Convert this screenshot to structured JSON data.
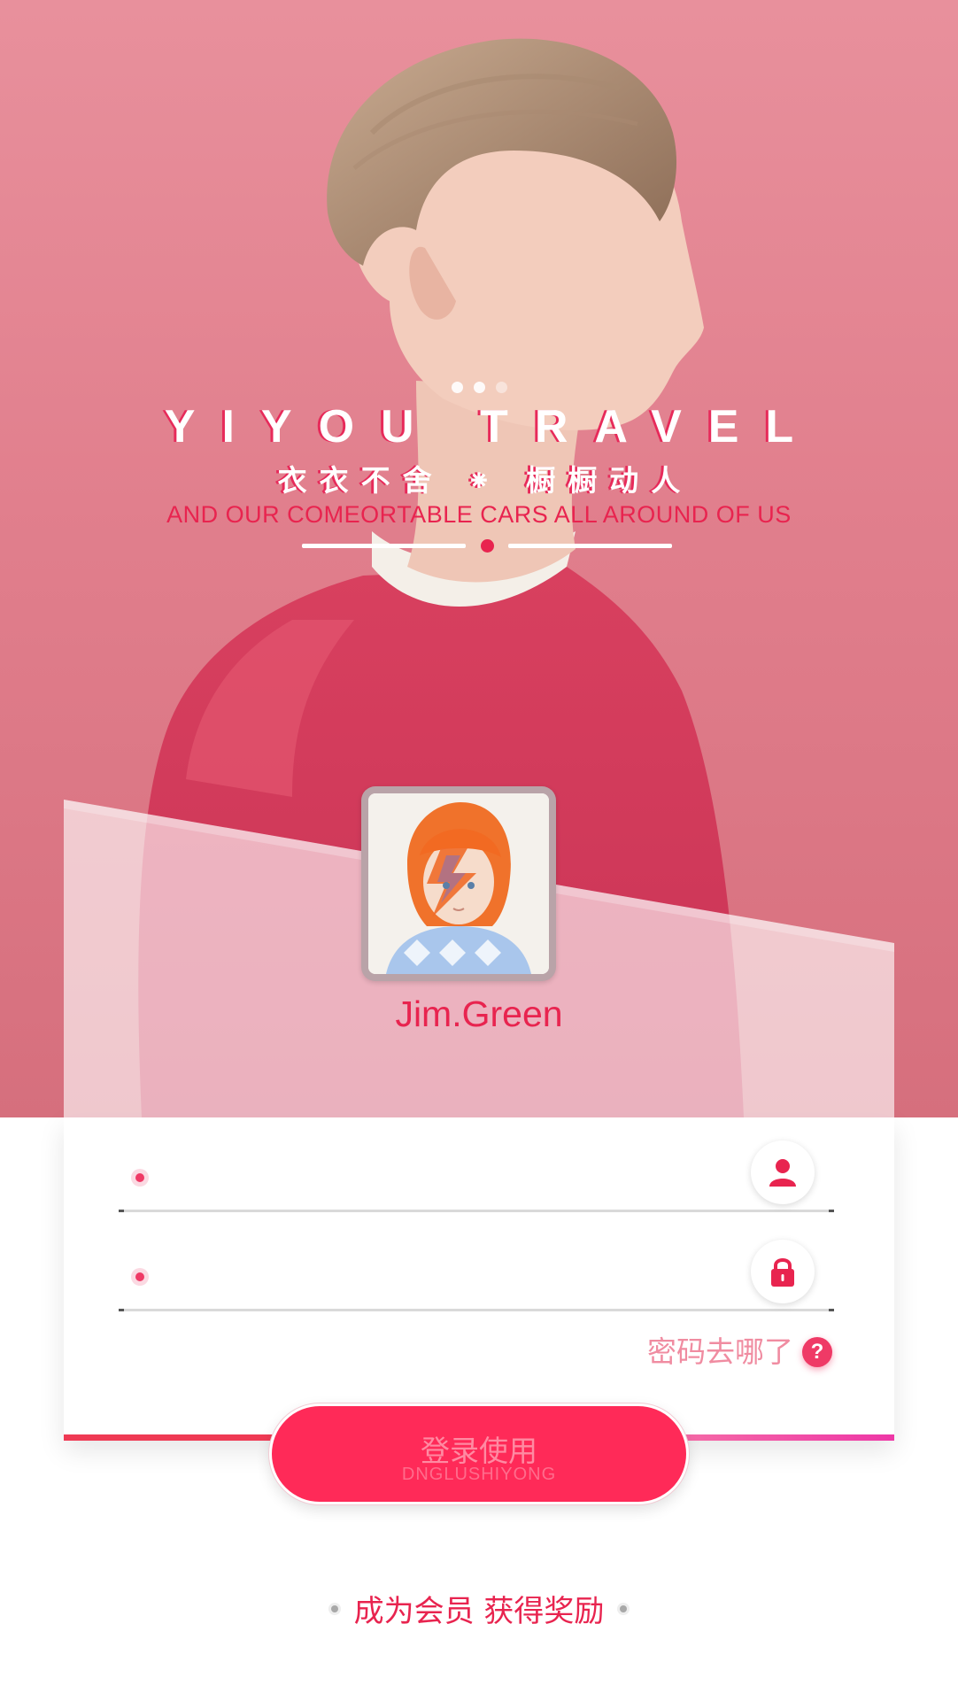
{
  "hero": {
    "slide_count": 3,
    "active_slide": 1,
    "title": "YIYOU TRAVEL",
    "subtitle": "衣衣不舍 ⁕ 橱橱动人",
    "tagline": "AND OUR COMEORTABLE CARS ALL AROUND OF US"
  },
  "profile": {
    "username": "Jim.Green",
    "avatar_icon": "child-portrait-avatar"
  },
  "login_form": {
    "username_value": "",
    "password_value": "",
    "username_icon": "user-icon",
    "password_icon": "lock-icon",
    "forgot_label": "密码去哪了",
    "help_icon": "?"
  },
  "login_button": {
    "label": "登录使用",
    "sublabel": "DNGLUSHIYONG"
  },
  "footer": {
    "register_label": "成为会员 获得奖励"
  },
  "colors": {
    "accent": "#ff2a58",
    "hero_background": "#e17f8d",
    "link": "#f08ca1"
  }
}
